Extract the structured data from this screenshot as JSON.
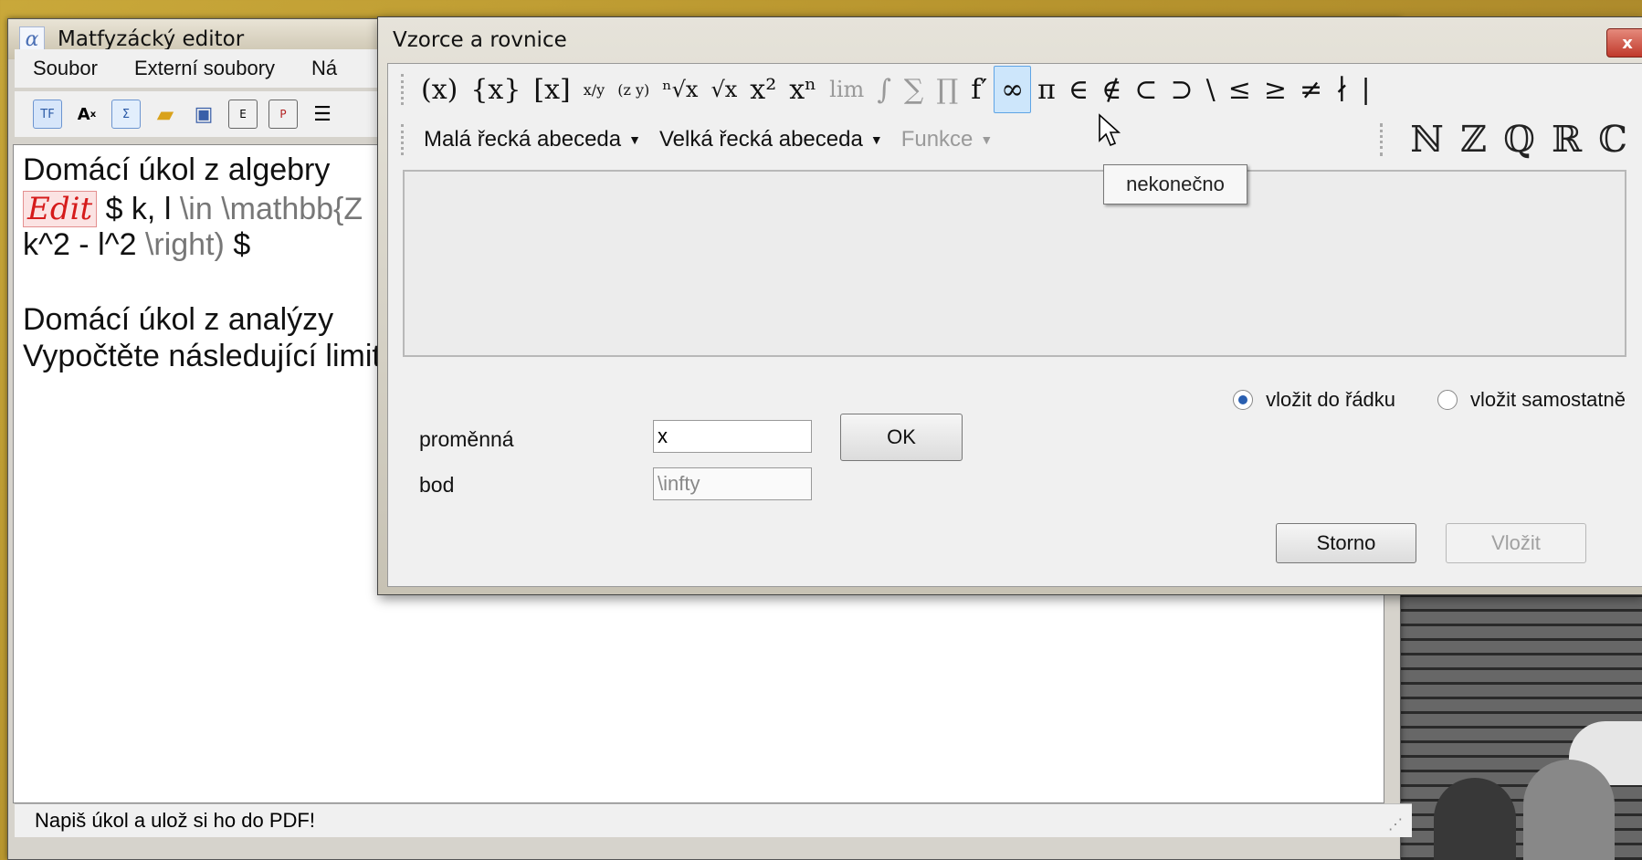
{
  "main_window": {
    "title": "Matfyzácký editor",
    "menu": [
      "Soubor",
      "Externí soubory",
      "Ná"
    ],
    "toolbar_icons": [
      "latex-icon",
      "font-size-icon",
      "insert-formula-icon",
      "open-folder-icon",
      "save-icon",
      "export-icon",
      "pdf-icon",
      "list-icon"
    ],
    "editor": {
      "line1": "Domácí úkol z algebry",
      "edit_tag": "Edit",
      "line2_a": "$ k, l",
      "line2_b": "\\in  \\mathbb{Z",
      "line3_a": "k^2 - l^2",
      "line3_b": "\\right)",
      "line3_c": "$",
      "line5": "Domácí úkol z analýzy",
      "line6": "Vypočtěte následující limitu"
    },
    "status": "Napiš úkol a ulož si ho do PDF!"
  },
  "dialog": {
    "title": "Vzorce a rovnice",
    "close": "x",
    "symbols": [
      "(x)",
      "{x}",
      "[x]",
      "x/y",
      "(z y)",
      "ⁿ√x",
      "√x",
      "x²",
      "xⁿ",
      "lim",
      "∫",
      "∑",
      "∏",
      "f′",
      "∞",
      "π",
      "∈",
      "∉",
      "⊂",
      "⊃",
      "\\",
      "≤",
      "≥",
      "≠",
      "∤",
      "|"
    ],
    "categories": [
      "Malá řecká abeceda",
      "Velká řecká abeceda",
      "Funkce"
    ],
    "sets": [
      "ℕ",
      "ℤ",
      "ℚ",
      "ℝ",
      "ℂ"
    ],
    "tooltip": "nekonečno",
    "radio_inline": "vložit do řádku",
    "radio_separate": "vložit samostatně",
    "variable_label": "proměnná",
    "variable_value": "x",
    "point_label": "bod",
    "point_value": "\\infty",
    "ok_label": "OK",
    "cancel_label": "Storno",
    "insert_label": "Vložit"
  }
}
